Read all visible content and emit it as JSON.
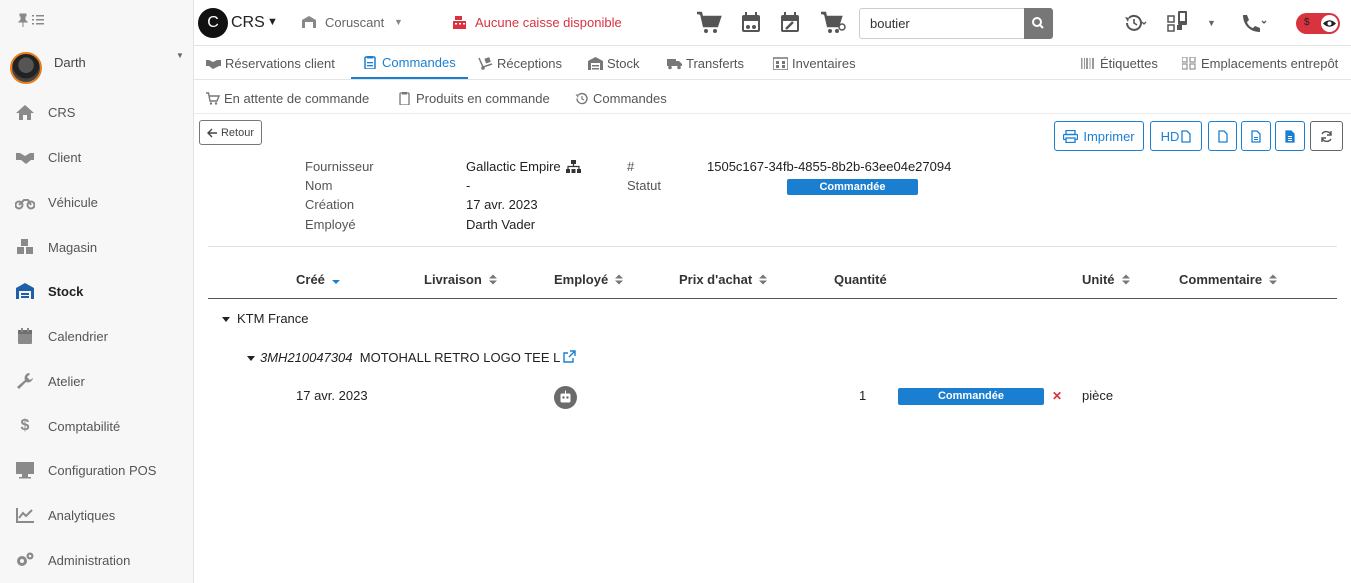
{
  "sidebar": {
    "user": {
      "name": "Darth"
    },
    "items": [
      {
        "label": "CRS",
        "icon": "home-icon"
      },
      {
        "label": "Client",
        "icon": "handshake-icon"
      },
      {
        "label": "Véhicule",
        "icon": "motorcycle-icon"
      },
      {
        "label": "Magasin",
        "icon": "cubes-icon"
      },
      {
        "label": "Stock",
        "icon": "warehouse-icon",
        "active": true
      },
      {
        "label": "Calendrier",
        "icon": "calendar-icon"
      },
      {
        "label": "Atelier",
        "icon": "wrench-icon"
      },
      {
        "label": "Comptabilité",
        "icon": "dollar-icon"
      },
      {
        "label": "Configuration POS",
        "icon": "monitor-icon"
      },
      {
        "label": "Analytiques",
        "icon": "chart-line-icon"
      },
      {
        "label": "Administration",
        "icon": "cogs-icon"
      }
    ]
  },
  "topbar": {
    "store_initial": "C",
    "store_name": "CRS",
    "location": "Coruscant",
    "register_status": "Aucune caisse disponible",
    "search_value": "boutier"
  },
  "tabs": [
    {
      "label": "Réservations client"
    },
    {
      "label": "Commandes",
      "active": true
    },
    {
      "label": "Réceptions"
    },
    {
      "label": "Stock"
    },
    {
      "label": "Transferts"
    },
    {
      "label": "Inventaires"
    },
    {
      "label": "Étiquettes"
    },
    {
      "label": "Emplacements entrepôt"
    }
  ],
  "subtabs": [
    {
      "label": "En attente de commande"
    },
    {
      "label": "Produits en commande"
    },
    {
      "label": "Commandes"
    }
  ],
  "actions": {
    "back": "Retour",
    "print": "Imprimer",
    "hd": "HD"
  },
  "order": {
    "labels": {
      "supplier": "Fournisseur",
      "name": "Nom",
      "created": "Création",
      "employee": "Employé",
      "id": "#",
      "status": "Statut"
    },
    "supplier": "Gallactic Empire",
    "name": "-",
    "created": "17 avr. 2023",
    "employee": "Darth Vader",
    "id": "1505c167-34fb-4855-8b2b-63ee04e27094",
    "status": "Commandée"
  },
  "table": {
    "headers": [
      "Créé",
      "Livraison",
      "Employé",
      "Prix d'achat",
      "Quantité",
      "Unité",
      "Commentaire"
    ],
    "group": "KTM France",
    "product": {
      "ref": "3MH210047304",
      "name": "MOTOHALL RETRO LOGO TEE L"
    },
    "row": {
      "created": "17 avr. 2023",
      "quantity": "1",
      "status": "Commandée",
      "unit": "pièce"
    }
  },
  "colors": {
    "accent": "#1b7fd1",
    "danger": "#d9333f"
  }
}
